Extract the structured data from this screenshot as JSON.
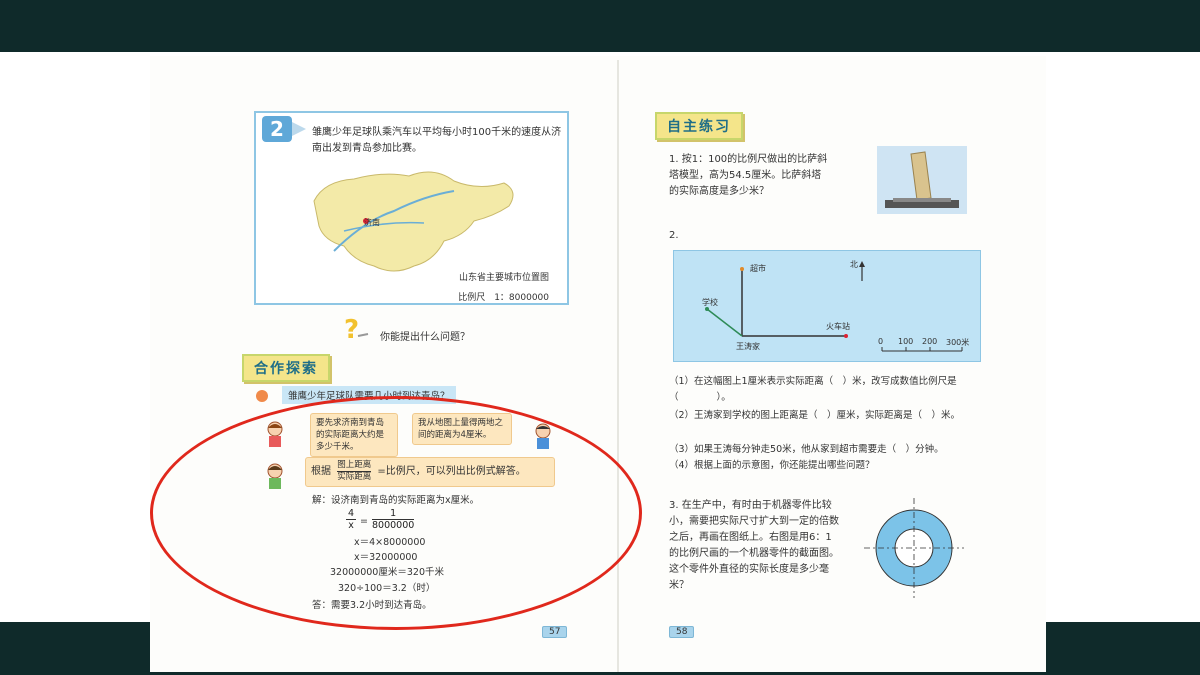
{
  "left_page": {
    "problem_number": "2",
    "problem_text": "雏鹰少年足球队乘汽车以平均每小时100千米的速度从济南出发到青岛参加比赛。",
    "map_city_label": "济南",
    "map_title": "山东省主要城市位置图",
    "map_scale": "比例尺　1：8000000",
    "prompt": "你能提出什么问题？",
    "section_title": "合作探索",
    "question": "雏鹰少年足球队需要几小时到达青岛？",
    "bubble1": "要先求济南到青岛的实际距离大约是多少千米。",
    "bubble2": "我从地图上量得两地之间的距离为4厘米。",
    "bubble3_prefix": "根据",
    "bubble3_frac_top": "图上距离",
    "bubble3_frac_bottom": "实际距离",
    "bubble3_suffix": "=比例尺，可以列出比例式解答。",
    "solution_intro": "解：设济南到青岛的实际距离为x厘米。",
    "eq1_left_top": "4",
    "eq1_left_bottom": "x",
    "eq1_equals": "=",
    "eq1_right_top": "1",
    "eq1_right_bottom": "8000000",
    "eq2": "x＝4×8000000",
    "eq3": "x＝32000000",
    "eq4": "32000000厘米＝320千米",
    "eq5": "320÷100＝3.2（时）",
    "answer": "答：需要3.2小时到达青岛。",
    "page_number": "57"
  },
  "right_page": {
    "section_title": "自主练习",
    "q1": "1. 按1：100的比例尺做出的比萨斜塔模型，高为54.5厘米。比萨斜塔的实际高度是多少米？",
    "q2": "2.",
    "diagram": {
      "supermarket": "超市",
      "school": "学校",
      "home": "王涛家",
      "station": "火车站",
      "north": "北",
      "scale_0": "0",
      "scale_100": "100",
      "scale_200": "200",
      "scale_300": "300米"
    },
    "q2_1": "（1）在这幅图上1厘米表示实际距离（　）米，改写成数值比例尺是（　　　　）。",
    "q2_2": "（2）王涛家到学校的图上距离是（　）厘米，实际距离是（　）米。",
    "q2_3": "（3）如果王涛每分钟走50米，他从家到超市需要走（　）分钟。",
    "q2_4": "（4）根据上面的示意图，你还能提出哪些问题？",
    "q3": "3. 在生产中，有时由于机器零件比较小，需要把实际尺寸扩大到一定的倍数之后，再画在图纸上。右图是用6：1的比例尺画的一个机器零件的截面图。这个零件外直径的实际长度是多少毫米？",
    "page_number": "58"
  },
  "colors": {
    "frame": "#0f2a2a",
    "highlight_ellipse": "#e0281c",
    "section_title_bg": "#f4e58a",
    "diagram_bg": "#bfe3f5"
  }
}
